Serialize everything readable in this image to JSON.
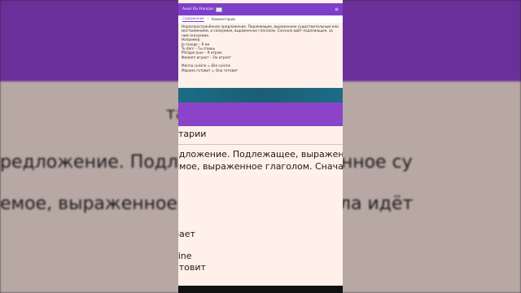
{
  "app": {
    "title": "Aussi Du Français",
    "flag_icon": "flag-icon",
    "menu_icon": "hamburger-menu-icon"
  },
  "tabs": [
    {
      "label": "Содержание",
      "active": true
    },
    {
      "label": "Комментарии",
      "active": false
    }
  ],
  "tab_separator": "/",
  "content": {
    "paragraph": "Нераспространённое предложение. Подлежащее, выраженное существительным или местоимением, и сказуемое, выраженное глаголом. Сначала идёт подлежащее, за ним сказуемое.",
    "example_label": "Например:",
    "examples": [
      "Je mange – Я ем",
      "Tu dors – Ты спишь",
      "Philippe joue – Я играю",
      "Филипп играет – Он играет"
    ],
    "examples2": [
      "Marina cuisine = Elle cuisine",
      "Марина готовит = Она готовит"
    ]
  },
  "zoomed": {
    "section": "тарии",
    "line1": "едложение. Подлежащее, выраженное су",
    "line2": "имое, выраженное глаголом. Сначала идё",
    "verb1": "рает",
    "verb2": "sine",
    "verb3": "отовит"
  },
  "background_zoom": {
    "section": "тарии",
    "line1": "редложение. Подлежащее, выраженное су",
    "line2": "емое, выраженное глаголом. Сначала идёт"
  },
  "colors": {
    "accent": "#7d3ec9",
    "page_bg": "#fff0ea",
    "teal_band": "#1b5e75",
    "purple_band": "#8b44c9"
  }
}
